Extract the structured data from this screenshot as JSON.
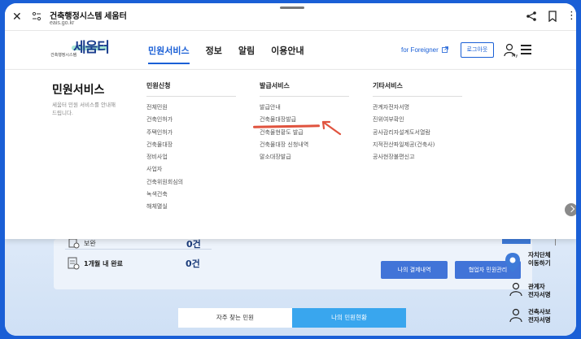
{
  "browser": {
    "title": "건축행정시스템 세움터",
    "url": "eais.go.kr",
    "close_glyph": "✕",
    "more_glyph": "⋮"
  },
  "header": {
    "logo_text": "세움터",
    "logo_sub": "건축행정시스템",
    "nav": [
      "민원서비스",
      "정보",
      "알림",
      "이용안내"
    ],
    "active_nav": "민원서비스",
    "foreigner_label": "for Foreigner",
    "login_label": "로그아웃"
  },
  "mega_menu": {
    "title": "민원서비스",
    "description": "세움터 민원 서비스를 안내해드립니다.",
    "columns": [
      {
        "title": "민원신청",
        "items": [
          "전체민원",
          "건축인허가",
          "주택인허가",
          "건축물대장",
          "정비사업",
          "사업자",
          "건축위원회심의",
          "녹색건축",
          "해체멸실"
        ]
      },
      {
        "title": "발급서비스",
        "items": [
          "발급안내",
          "건축물대장발급",
          "건축물현황도 발급",
          "건축물대장 신청내역",
          "말소대장발급"
        ]
      },
      {
        "title": "기타서비스",
        "items": [
          "관계자전자서명",
          "진위여부확인",
          "공사감리자설계도서열람",
          "지적전산파일제공(건축사)",
          "공사현장불편신고"
        ]
      }
    ],
    "highlighted_item": "건축물대장발급",
    "annotation_color": "#e0533e"
  },
  "background_page": {
    "row1": {
      "label": "보완",
      "count": "0건"
    },
    "row2": {
      "label": "1개월 내 완료",
      "count": "0건"
    },
    "pay_button": "나의 결제내역",
    "coop_button": "협업자 민원관리",
    "tabs": [
      "자주 찾는 민원",
      "나의 민원현황"
    ],
    "active_tab": "나의 민원현황"
  },
  "side_menu": [
    {
      "label_line1": "자치단체",
      "label_line2": "이동하기",
      "icon": "map-pin-icon"
    },
    {
      "label_line1": "관계자",
      "label_line2": "전자서명",
      "icon": "person-icon"
    },
    {
      "label_line1": "건축사보",
      "label_line2": "전자서명",
      "icon": "person-icon"
    }
  ],
  "colors": {
    "brand_blue": "#1a5fd6",
    "button_blue": "#4174d8",
    "tab_blue": "#39a6ee"
  }
}
